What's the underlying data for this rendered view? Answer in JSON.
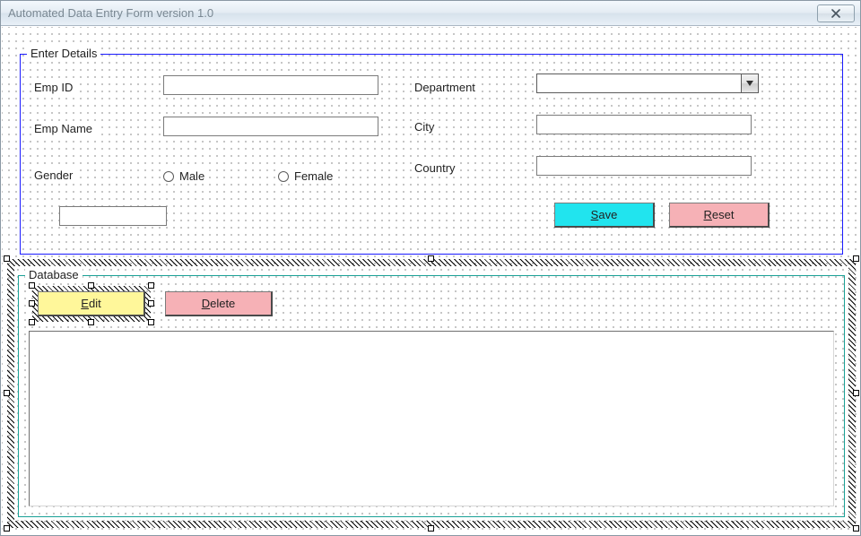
{
  "window": {
    "title": "Automated Data Entry Form version 1.0"
  },
  "enterDetails": {
    "legend": "Enter Details",
    "empId": {
      "label": "Emp ID",
      "value": ""
    },
    "empName": {
      "label": "Emp Name",
      "value": ""
    },
    "gender": {
      "label": "Gender",
      "male": "Male",
      "female": "Female"
    },
    "department": {
      "label": "Department",
      "value": ""
    },
    "city": {
      "label": "City",
      "value": ""
    },
    "country": {
      "label": "Country",
      "value": ""
    },
    "extra": {
      "value": ""
    }
  },
  "buttons": {
    "save": "Save",
    "reset": "Reset",
    "edit": "Edit",
    "delete": "Delete"
  },
  "database": {
    "legend": "Database"
  }
}
